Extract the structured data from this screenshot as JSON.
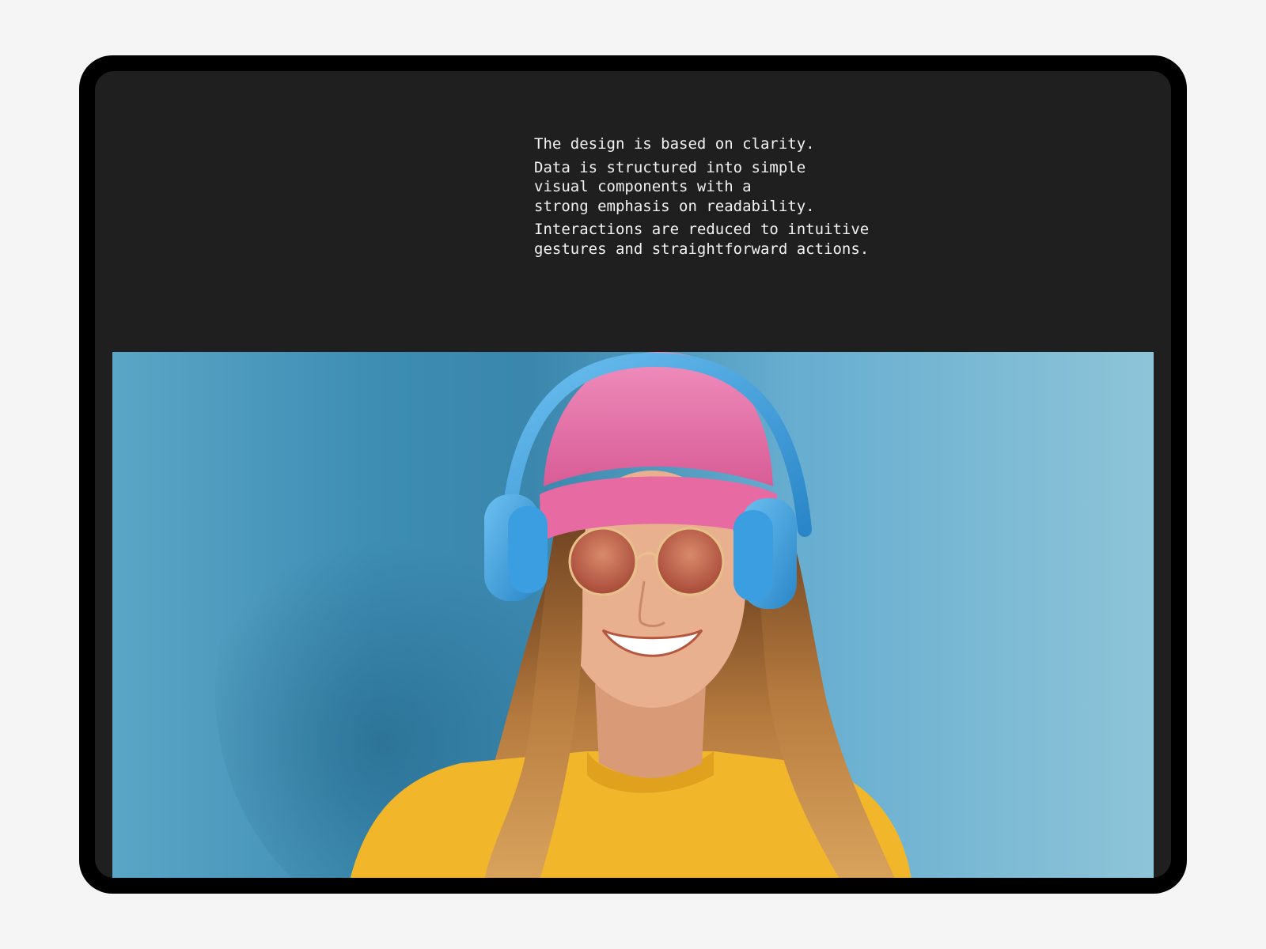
{
  "device": {
    "frame_color": "#000000",
    "screen_color": "#1f1f1f",
    "page_background": "#f5f5f5"
  },
  "copy": {
    "paragraphs": [
      "The design is based on clarity.",
      "Data is structured into simple\nvisual components with a\nstrong emphasis on readability.",
      "Interactions are reduced to intuitive\ngestures and straightforward actions."
    ]
  },
  "photo": {
    "subject": "woman-with-headphones",
    "colors": {
      "background": "#5aa6c7",
      "beanie": "#e86fa5",
      "headphones": "#3b9ee0",
      "sweater": "#f2b62a",
      "hair": "#b57a3e",
      "skin": "#e8b08f",
      "lenses": "#c86a52"
    }
  }
}
